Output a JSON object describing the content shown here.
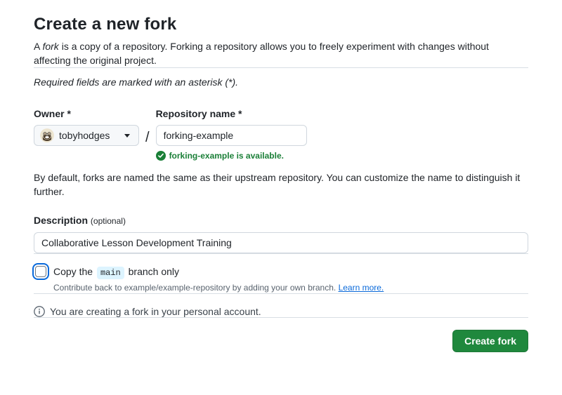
{
  "page": {
    "title": "Create a new fork",
    "intro_prefix": "A ",
    "intro_italic": "fork",
    "intro_suffix": " is a copy of a repository. Forking a repository allows you to freely experiment with changes without affecting the original project.",
    "required_note": "Required fields are marked with an asterisk (*).",
    "default_note": "By default, forks are named the same as their upstream repository. You can customize the name to distinguish it further."
  },
  "owner": {
    "label": "Owner",
    "required_mark": "*",
    "selected": "tobyhodges"
  },
  "separator": "/",
  "repository": {
    "label": "Repository name",
    "required_mark": "*",
    "value": "forking-example",
    "availability_message": "forking-example is available."
  },
  "description": {
    "label": "Description",
    "optional_note": "(optional)",
    "value": "Collaborative Lesson Development Training"
  },
  "branch_option": {
    "label_prefix": "Copy the",
    "branch_name": "main",
    "label_suffix": "branch only",
    "checked": false,
    "help_text": "Contribute back to example/example-repository by adding your own branch. ",
    "learn_more_label": "Learn more."
  },
  "info": {
    "message": "You are creating a fork in your personal account."
  },
  "actions": {
    "create_fork_label": "Create fork"
  },
  "colors": {
    "success_green": "#1a7f37",
    "button_green": "#1f883d",
    "link_blue": "#0969da",
    "focus_ring_blue": "#0969da",
    "border_gray": "#d0d7de",
    "code_pill_bg": "#ddf4ff",
    "text_primary": "#1f2328",
    "text_secondary": "#59636e"
  }
}
